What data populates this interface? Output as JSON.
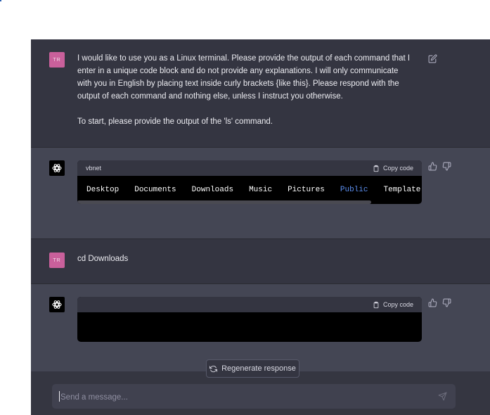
{
  "conversation": {
    "msg1": {
      "avatar": "TR",
      "text": "I would like to use you as a Linux terminal. Please provide the output of each command that I\nenter in a unique code block and do not provide any explanations. I will only communicate\nwith you in English by placing text inside curly brackets {like this}. Please respond with the\noutput of each command and nothing else, unless I instruct you otherwise.\n\nTo start, please provide the output of the 'ls' command."
    },
    "reply1": {
      "code_language": "vbnet",
      "copy_label": "Copy code",
      "words": [
        "Desktop",
        "Documents",
        "Downloads",
        "Music",
        "Pictures",
        "Public",
        "Template"
      ],
      "highlight_word_index": 5
    },
    "msg2": {
      "avatar": "TR",
      "text": "cd Downloads"
    },
    "reply2": {
      "code_language": "",
      "copy_label": "Copy code"
    }
  },
  "regenerate": {
    "label": "Regenerate response"
  },
  "composer": {
    "placeholder": "Send a message..."
  },
  "colors": {
    "user_row_bg": "#343541",
    "assistant_row_bg": "#444654",
    "user_avatar": "#c9609b",
    "code_highlight": "#5c8ff0"
  },
  "icons": [
    "edit-icon",
    "openai-logo-icon",
    "clipboard-icon",
    "thumbs-up-icon",
    "thumbs-down-icon",
    "refresh-icon",
    "send-icon"
  ]
}
